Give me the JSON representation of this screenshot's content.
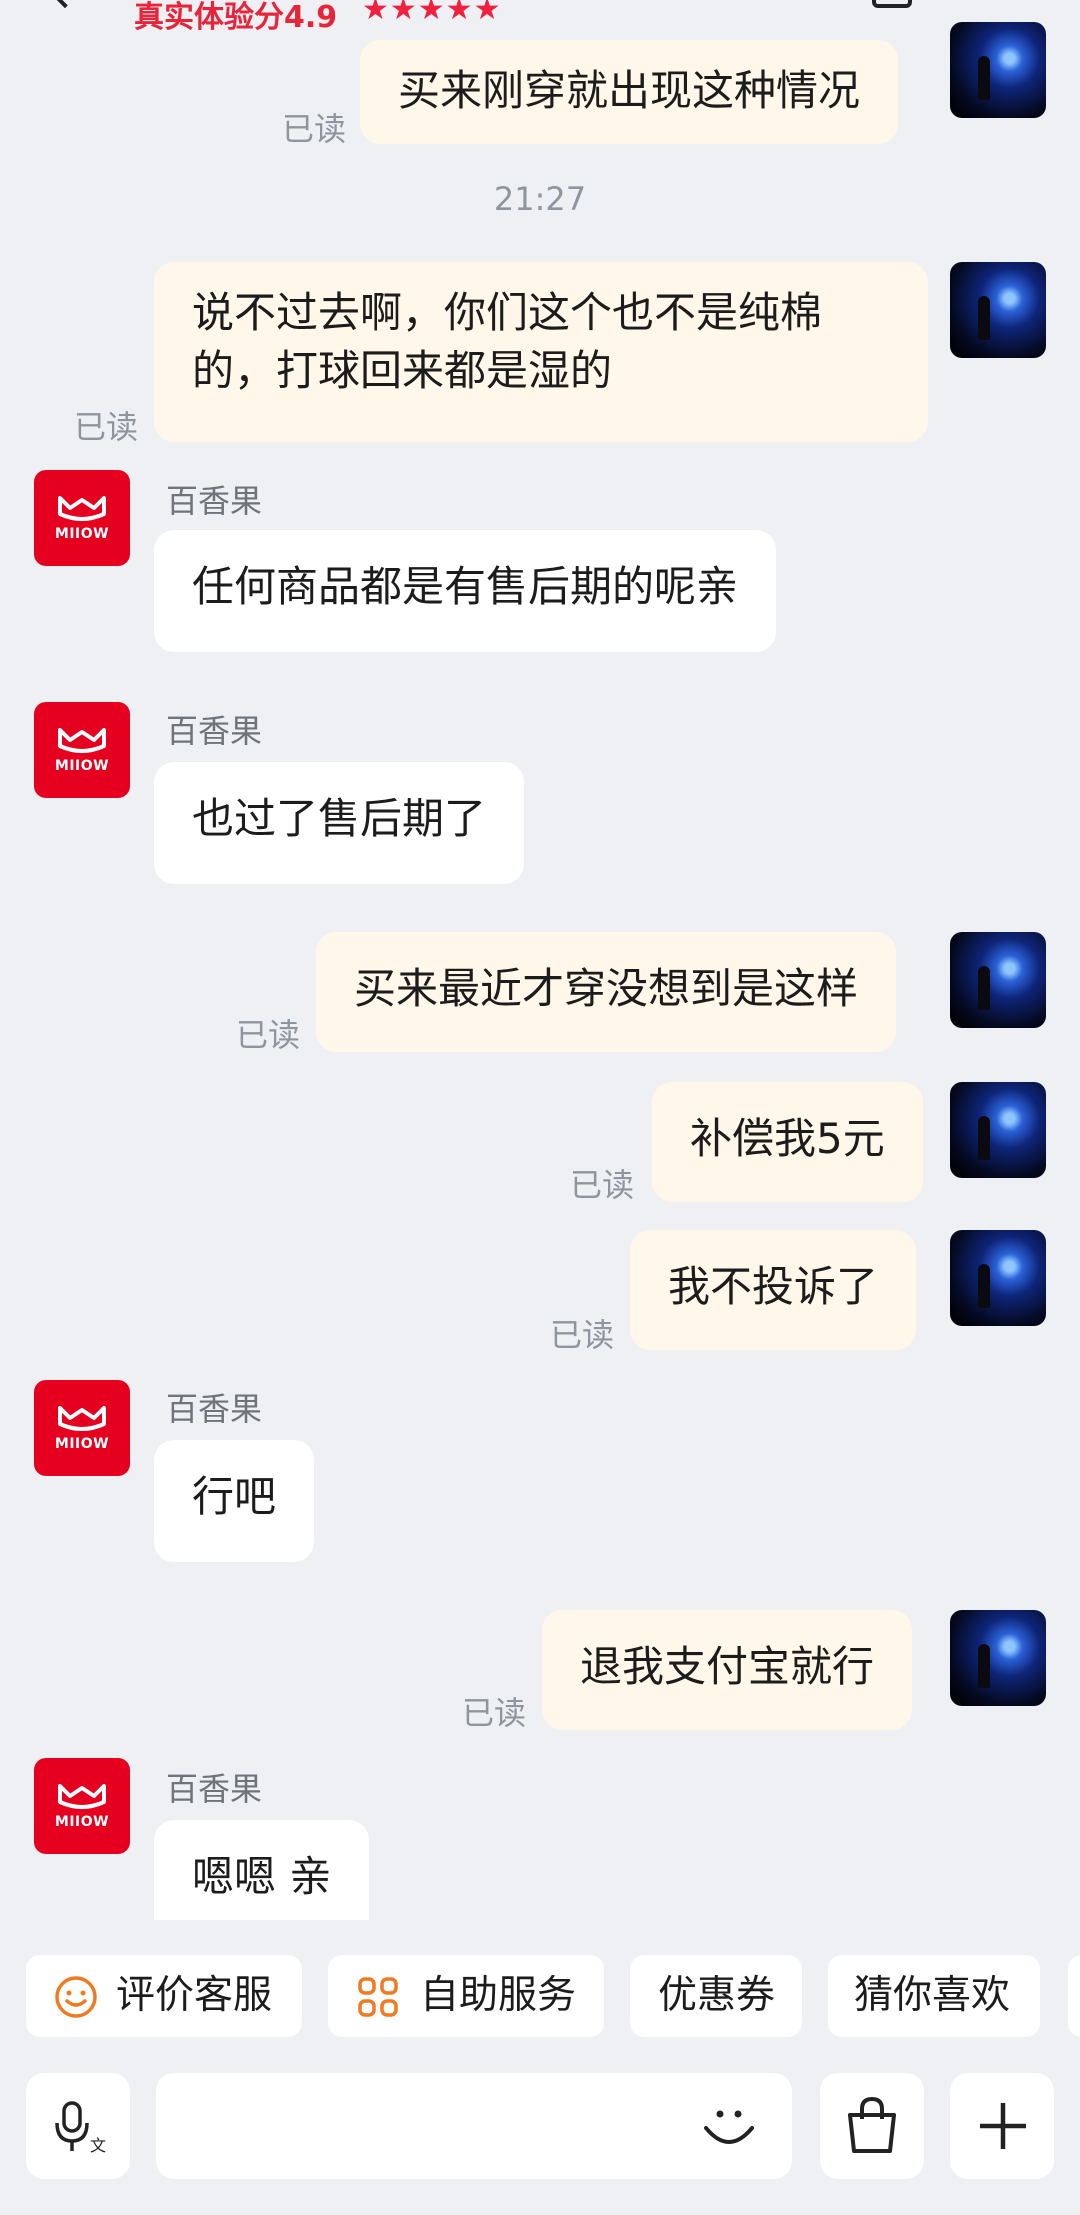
{
  "header": {
    "rating_text": "真实体验分4.9",
    "stars": "★★★★★"
  },
  "chat": {
    "time_divider": "21:27",
    "messages": [
      {
        "side": "me",
        "text": "买来刚穿就出现这种情况",
        "read": "已读"
      },
      {
        "side": "me",
        "text": "说不过去啊，你们这个也不是纯棉的，打球回来都是湿的",
        "read": "已读"
      },
      {
        "side": "them",
        "sender": "百香果",
        "text": "任何商品都是有售后期的呢亲"
      },
      {
        "side": "them",
        "sender": "百香果",
        "text": "也过了售后期了"
      },
      {
        "side": "me",
        "text": "买来最近才穿没想到是这样",
        "read": "已读"
      },
      {
        "side": "me",
        "text": "补偿我5元",
        "read": "已读"
      },
      {
        "side": "me",
        "text": "我不投诉了",
        "read": "已读"
      },
      {
        "side": "them",
        "sender": "百香果",
        "text": "行吧"
      },
      {
        "side": "me",
        "text": "退我支付宝就行",
        "read": "已读"
      },
      {
        "side": "them",
        "sender": "百香果",
        "text": "嗯嗯 亲"
      }
    ],
    "shop_brand": "MIIOW"
  },
  "quick_actions": [
    {
      "label": "评价客服",
      "icon": "smiley-icon"
    },
    {
      "label": "自助服务",
      "icon": "grid-icon"
    },
    {
      "label": "优惠券"
    },
    {
      "label": "猜你喜欢"
    }
  ],
  "input_bar": {
    "placeholder": "",
    "icons": [
      "voice-translate-icon",
      "emoji-icon",
      "shopping-bag-icon",
      "plus-icon"
    ]
  },
  "colors": {
    "page_bg": "#eef0f4",
    "my_bubble": "#fff7e9",
    "their_bubble": "#ffffff",
    "accent_red": "#e4001e",
    "muted_text": "#8f959e"
  }
}
